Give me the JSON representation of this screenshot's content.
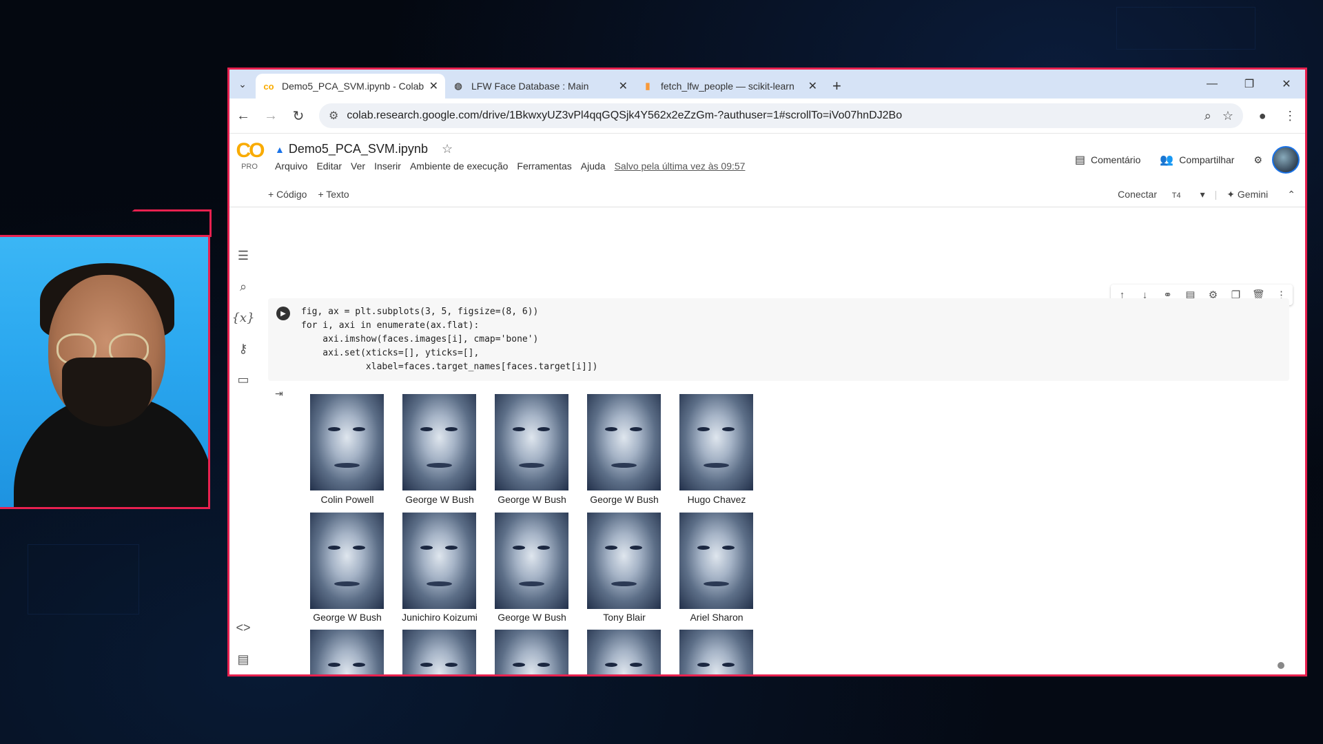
{
  "browser": {
    "tabs": [
      {
        "label": "Demo5_PCA_SVM.ipynb - Colab",
        "icon": "colab-icon",
        "active": true
      },
      {
        "label": "LFW Face Database : Main",
        "icon": "globe-icon",
        "active": false
      },
      {
        "label": "fetch_lfw_people — scikit-learn",
        "icon": "sklearn-icon",
        "active": false
      }
    ],
    "url": "colab.research.google.com/drive/1BkwxyUZ3vPl4qqGQSjk4Y562x2eZzGm-?authuser=1#scrollTo=iVo07hnDJ2Bo"
  },
  "colab": {
    "logo_text": "CO",
    "pro_label": "PRO",
    "notebook_title": "Demo5_PCA_SVM.ipynb",
    "menus": [
      "Arquivo",
      "Editar",
      "Ver",
      "Inserir",
      "Ambiente de execução",
      "Ferramentas",
      "Ajuda"
    ],
    "saved_status": "Salvo pela última vez às 09:57",
    "comment_label": "Comentário",
    "share_label": "Compartilhar",
    "add_code_label": "+ Código",
    "add_text_label": "+ Texto",
    "connect_label": "Conectar",
    "connect_runtime": "T4",
    "gemini_label": "Gemini"
  },
  "cell": {
    "code_lines": [
      "fig, ax = plt.subplots(3, 5, figsize=(8, 6))",
      "for i, axi in enumerate(ax.flat):",
      "    axi.imshow(faces.images[i], cmap='bone')",
      "    axi.set(xticks=[], yticks=[],",
      "            xlabel=faces.target_names[faces.target[i]])"
    ]
  },
  "faces": [
    [
      "Colin Powell",
      "George W Bush",
      "George W Bush",
      "George W Bush",
      "Hugo Chavez"
    ],
    [
      "George W Bush",
      "Junichiro Koizumi",
      "George W Bush",
      "Tony Blair",
      "Ariel Sharon"
    ],
    [
      "",
      "",
      "",
      "",
      ""
    ]
  ]
}
